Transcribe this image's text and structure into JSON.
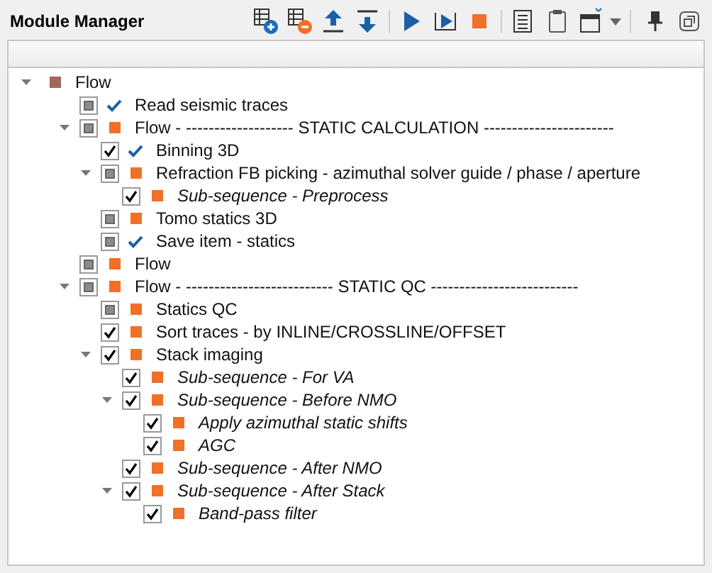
{
  "panel": {
    "title": "Module Manager"
  },
  "tree": [
    {
      "label": "Flow",
      "kind": "square",
      "color": "#a0675a",
      "root": true,
      "expanded": true,
      "italic": false,
      "children": [
        {
          "label": "Read seismic traces",
          "kind": "tick",
          "checked": false,
          "italic": false
        },
        {
          "label": "Flow - ------------------- STATIC CALCULATION -----------------------",
          "kind": "square",
          "color": "#f07028",
          "checked": false,
          "expanded": true,
          "italic": false,
          "children": [
            {
              "label": "Binning 3D",
              "kind": "tick",
              "checked": true,
              "italic": false
            },
            {
              "label": "Refraction FB picking - azimuthal solver guide / phase / aperture",
              "kind": "square",
              "color": "#f07028",
              "checked": false,
              "expanded": true,
              "italic": false,
              "children": [
                {
                  "label": "Sub-sequence - Preprocess",
                  "kind": "square",
                  "color": "#f07028",
                  "checked": true,
                  "italic": true
                }
              ]
            },
            {
              "label": "Tomo statics 3D",
              "kind": "square",
              "color": "#f07028",
              "checked": false,
              "italic": false
            },
            {
              "label": "Save item - statics",
              "kind": "tick",
              "checked": false,
              "italic": false
            }
          ]
        },
        {
          "label": "Flow",
          "kind": "square",
          "color": "#f07028",
          "checked": false,
          "italic": false
        },
        {
          "label": "Flow - -------------------------- STATIC QC --------------------------",
          "kind": "square",
          "color": "#f07028",
          "checked": false,
          "expanded": true,
          "italic": false,
          "children": [
            {
              "label": "Statics QC",
              "kind": "square",
              "color": "#f07028",
              "checked": false,
              "italic": false
            },
            {
              "label": "Sort traces - by INLINE/CROSSLINE/OFFSET",
              "kind": "square",
              "color": "#f07028",
              "checked": true,
              "italic": false
            },
            {
              "label": "Stack imaging",
              "kind": "square",
              "color": "#f07028",
              "checked": true,
              "expanded": true,
              "italic": false,
              "children": [
                {
                  "label": "Sub-sequence - For VA",
                  "kind": "square",
                  "color": "#f07028",
                  "checked": true,
                  "italic": true
                },
                {
                  "label": "Sub-sequence - Before NMO",
                  "kind": "square",
                  "color": "#f07028",
                  "checked": true,
                  "expanded": true,
                  "italic": true,
                  "children": [
                    {
                      "label": "Apply azimuthal static shifts",
                      "kind": "square",
                      "color": "#f07028",
                      "checked": true,
                      "italic": true
                    },
                    {
                      "label": "AGC",
                      "kind": "square",
                      "color": "#f07028",
                      "checked": true,
                      "italic": true
                    }
                  ]
                },
                {
                  "label": "Sub-sequence - After NMO",
                  "kind": "square",
                  "color": "#f07028",
                  "checked": true,
                  "italic": true
                },
                {
                  "label": "Sub-sequence - After Stack",
                  "kind": "square",
                  "color": "#f07028",
                  "checked": true,
                  "expanded": true,
                  "italic": true,
                  "children": [
                    {
                      "label": "Band-pass filter",
                      "kind": "square",
                      "color": "#f07028",
                      "checked": true,
                      "italic": true
                    }
                  ]
                }
              ]
            }
          ]
        }
      ]
    }
  ]
}
